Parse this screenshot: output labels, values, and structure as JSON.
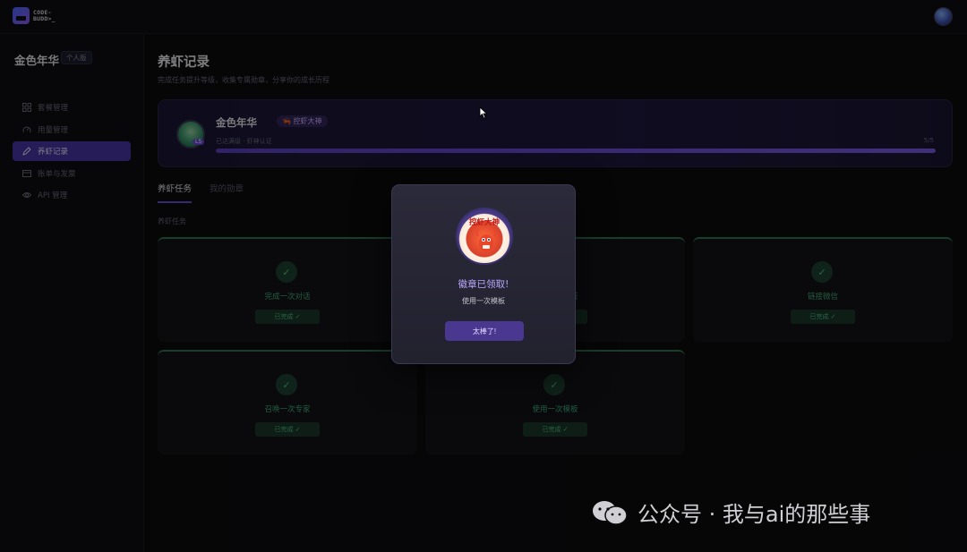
{
  "app": {
    "logo_line1": "CODE-",
    "logo_line2": "BUDD>_"
  },
  "sidebar": {
    "user_name": "金色年华",
    "plan_badge": "个人版",
    "items": [
      {
        "label": "套餐管理",
        "icon": "grid-icon"
      },
      {
        "label": "用量管理",
        "icon": "gauge-icon"
      },
      {
        "label": "养虾记录",
        "icon": "pencil-icon",
        "active": true
      },
      {
        "label": "账单与发票",
        "icon": "card-icon"
      },
      {
        "label": "API 管理",
        "icon": "eye-icon"
      }
    ]
  },
  "page": {
    "title": "养虾记录",
    "subtitle": "完成任务提升等级，收集专属勋章，分享你的成长历程"
  },
  "profile": {
    "name": "金色年华",
    "level_badge": "L5",
    "title_badge": "控虾大神",
    "progress_label": "已达满级 · 虾神认证",
    "progress_count": "5/5",
    "progress_fraction": 1.0
  },
  "tabs": [
    "养虾任务",
    "我的勋章"
  ],
  "section_label": "养虾任务",
  "tasks": [
    {
      "name": "完成一次对话",
      "status": "已完成 ✓"
    },
    {
      "name": "使用一次模板",
      "status": "已完成 ✓"
    },
    {
      "name": "链接微信",
      "status": "已完成 ✓"
    },
    {
      "name": "召唤一次专家",
      "status": "已完成 ✓"
    },
    {
      "name": "使用一次模板",
      "status": "已完成 ✓"
    }
  ],
  "modal": {
    "badge_text": "控虾大神",
    "title": "徽章已领取!",
    "subtitle": "使用一次模板",
    "button": "太棒了!"
  },
  "watermark": {
    "text": "公众号 · 我与ai的那些事"
  },
  "colors": {
    "accent": "#4a36a8",
    "success": "#4cc388",
    "modal_title": "#b9a8ff"
  }
}
